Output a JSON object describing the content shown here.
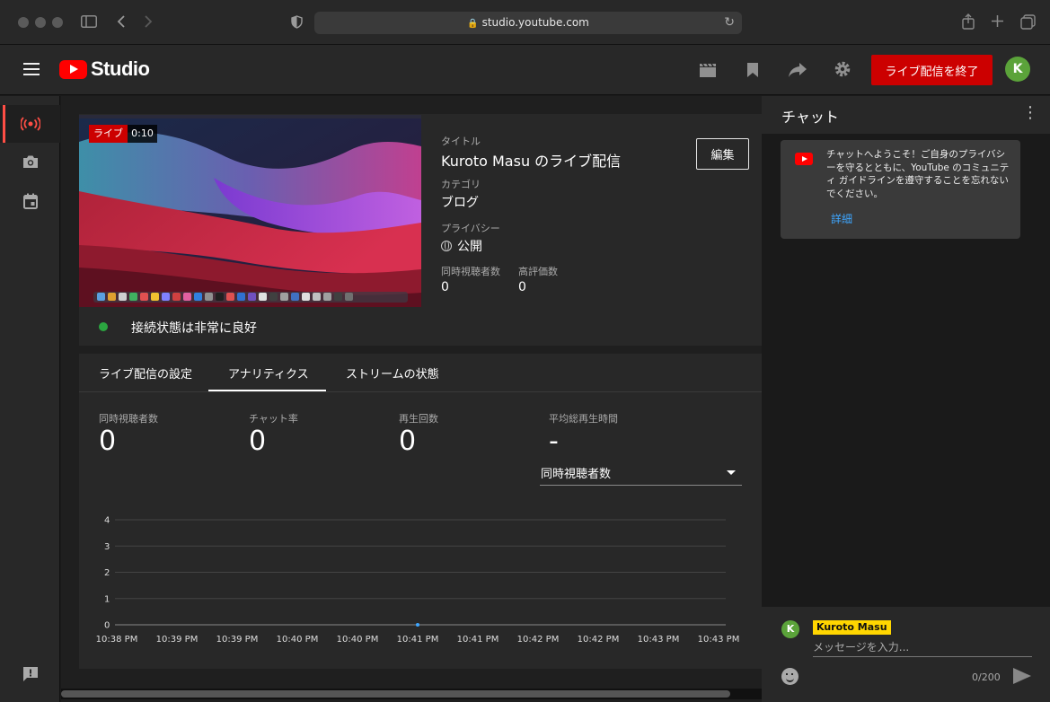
{
  "browser": {
    "url": "studio.youtube.com"
  },
  "header": {
    "logo_text": "Studio",
    "end_live_label": "ライブ配信を終了",
    "avatar_initial": "K"
  },
  "stream": {
    "live_badge": "ライブ",
    "elapsed": "0:10",
    "title_label": "タイトル",
    "title": "Kuroto Masu のライブ配信",
    "category_label": "カテゴリ",
    "category": "ブログ",
    "privacy_label": "プライバシー",
    "privacy": "公開",
    "concurrent_label": "同時視聴者数",
    "concurrent_value": "0",
    "likes_label": "高評価数",
    "likes_value": "0",
    "edit_label": "編集",
    "connection_status": "接続状態は非常に良好"
  },
  "tabs": [
    {
      "label": "ライブ配信の設定"
    },
    {
      "label": "アナリティクス"
    },
    {
      "label": "ストリームの状態"
    }
  ],
  "metrics": [
    {
      "label": "同時視聴者数",
      "value": "0"
    },
    {
      "label": "チャット率",
      "value": "0"
    },
    {
      "label": "再生回数",
      "value": "0"
    },
    {
      "label": "平均総再生時間",
      "value": "-"
    }
  ],
  "metric_select": {
    "selected": "同時視聴者数"
  },
  "chart_data": {
    "type": "line",
    "title": "",
    "xlabel": "",
    "ylabel": "",
    "ylim": [
      0,
      4
    ],
    "y_ticks": [
      "0",
      "1",
      "2",
      "3",
      "4"
    ],
    "x_ticks": [
      "10:38 PM",
      "10:39 PM",
      "10:39 PM",
      "10:40 PM",
      "10:40 PM",
      "10:41 PM",
      "10:41 PM",
      "10:42 PM",
      "10:42 PM",
      "10:43 PM",
      "10:43 PM"
    ],
    "grid": true,
    "series": [
      {
        "values": [
          0,
          0,
          0,
          0,
          0,
          0,
          0,
          0,
          0,
          0,
          0
        ],
        "marker_at": "10:41 PM"
      }
    ]
  },
  "chat": {
    "title": "チャット",
    "welcome_text": "チャットへようこそ！ご自身のプライバシーを守るとともに、YouTube のコミュニティ ガイドラインを遵守することを忘れないでください。",
    "welcome_link": "詳細",
    "user_initial": "K",
    "user_name": "Kuroto Masu",
    "input_placeholder": "メッセージを入力...",
    "char_count": "0/200"
  },
  "colors": {
    "accent_red": "#cc0000",
    "status_green": "#2ba640",
    "link_blue": "#3ea6ff",
    "name_chip": "#ffd600"
  }
}
